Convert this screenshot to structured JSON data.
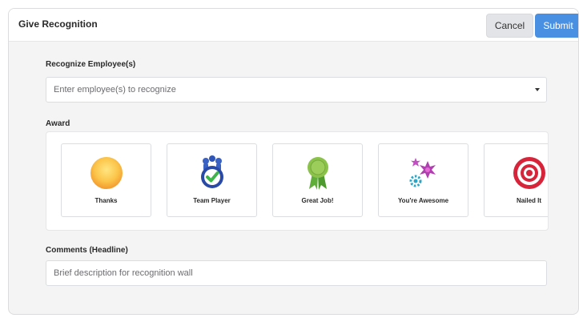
{
  "header": {
    "title": "Give Recognition",
    "cancel_label": "Cancel",
    "submit_label": "Submit"
  },
  "employee": {
    "label": "Recognize Employee(s)",
    "placeholder": "Enter employee(s) to recognize"
  },
  "award": {
    "label": "Award",
    "items": [
      {
        "label": "Thanks",
        "icon": "sun-icon"
      },
      {
        "label": "Team Player",
        "icon": "team-player-icon"
      },
      {
        "label": "Great Job!",
        "icon": "ribbon-icon"
      },
      {
        "label": "You're Awesome",
        "icon": "starburst-icon"
      },
      {
        "label": "Nailed It",
        "icon": "target-icon"
      }
    ]
  },
  "comments": {
    "label": "Comments (Headline)",
    "placeholder": "Brief description for recognition wall"
  },
  "colors": {
    "accent": "#4a90e2",
    "background": "#f4f4f5"
  }
}
